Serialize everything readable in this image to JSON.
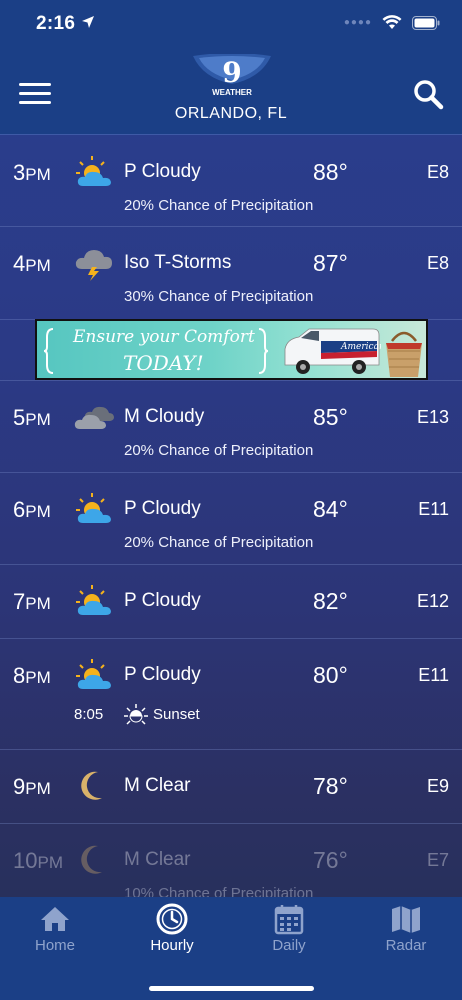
{
  "status": {
    "time": "2:16"
  },
  "header": {
    "logo_number": "9",
    "logo_word": "WEATHER",
    "city": "ORLANDO, FL"
  },
  "rows": [
    {
      "hour": "3",
      "ampm": "PM",
      "icon": "partly-cloudy-icon",
      "condition": "P Cloudy",
      "temp": "88°",
      "wind": "E8",
      "precip": "20% Chance of Precipitation"
    },
    {
      "hour": "4",
      "ampm": "PM",
      "icon": "thunderstorm-icon",
      "condition": "Iso T-Storms",
      "temp": "87°",
      "wind": "E8",
      "precip": "30% Chance of Precipitation"
    },
    {
      "hour": "5",
      "ampm": "PM",
      "icon": "mostly-cloudy-icon",
      "condition": "M Cloudy",
      "temp": "85°",
      "wind": "E13",
      "precip": "20% Chance of Precipitation"
    },
    {
      "hour": "6",
      "ampm": "PM",
      "icon": "partly-cloudy-icon",
      "condition": "P Cloudy",
      "temp": "84°",
      "wind": "E11",
      "precip": "20% Chance of Precipitation"
    },
    {
      "hour": "7",
      "ampm": "PM",
      "icon": "partly-cloudy-icon",
      "condition": "P Cloudy",
      "temp": "82°",
      "wind": "E12"
    },
    {
      "hour": "8",
      "ampm": "PM",
      "icon": "partly-cloudy-icon",
      "condition": "P Cloudy",
      "temp": "80°",
      "wind": "E11",
      "sunset_time": "8:05",
      "sunset_label": "Sunset"
    },
    {
      "hour": "9",
      "ampm": "PM",
      "icon": "moon-icon",
      "condition": "M Clear",
      "temp": "78°",
      "wind": "E9"
    },
    {
      "hour": "10",
      "ampm": "PM",
      "icon": "moon-icon",
      "condition": "M Clear",
      "temp": "76°",
      "wind": "E7",
      "precip": "10% Chance of Precipitation"
    }
  ],
  "ad": {
    "headline": "Ensure your Comfort",
    "subline": "TODAY!",
    "brand": "American"
  },
  "tabs": [
    {
      "label": "Home",
      "icon": "home-icon"
    },
    {
      "label": "Hourly",
      "icon": "clock-icon",
      "active": true
    },
    {
      "label": "Daily",
      "icon": "calendar-icon"
    },
    {
      "label": "Radar",
      "icon": "map-icon"
    }
  ],
  "colors": {
    "header_bg": "#1b3f86",
    "sun": "#f5b21c",
    "cloud": "#3da6e8",
    "moon": "#d9b26a"
  }
}
